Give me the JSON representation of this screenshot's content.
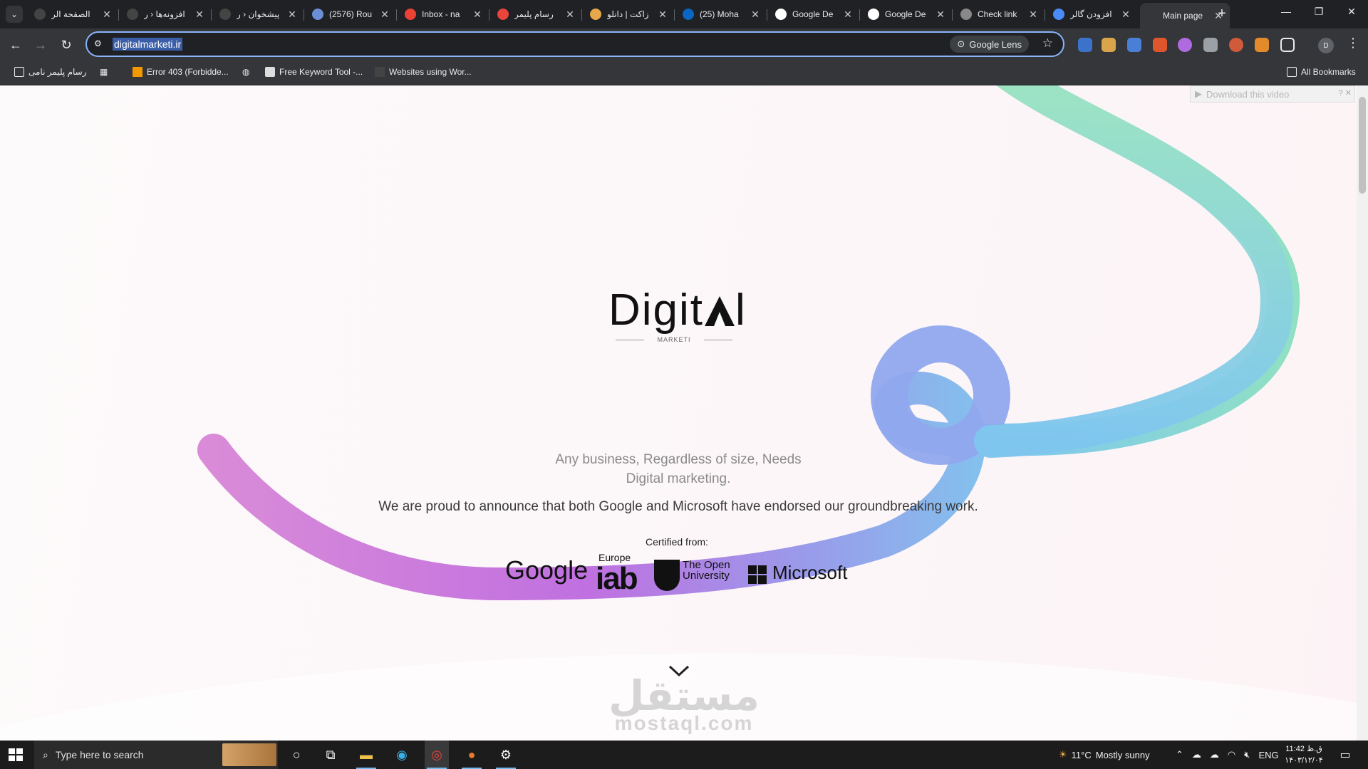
{
  "browser": {
    "tabs": [
      {
        "label": "الصفحة الر",
        "fav_color": "#444"
      },
      {
        "label": "افزونه‌ها ‹ ر",
        "fav_color": "#444"
      },
      {
        "label": "پیشخوان ‹ ر",
        "fav_color": "#444"
      },
      {
        "label": "(2576) Rou",
        "fav_color": "#6b8fd6"
      },
      {
        "label": "Inbox - na",
        "fav_color": "#ea4335"
      },
      {
        "label": "رسام پلیمر",
        "fav_color": "#e8453c"
      },
      {
        "label": "زاکت | دانلو",
        "fav_color": "#e6a84a"
      },
      {
        "label": "(25) Moha",
        "fav_color": "#0a66c2"
      },
      {
        "label": "Google De",
        "fav_color": "#ffffff"
      },
      {
        "label": "Google De",
        "fav_color": "#ffffff"
      },
      {
        "label": "Check link",
        "fav_color": "#888888"
      },
      {
        "label": "افزودن گالر",
        "fav_color": "#4a8cf7"
      },
      {
        "label": "Main page",
        "fav_color": "#35363a"
      }
    ],
    "new_tab_label": "+",
    "url": "digitalmarketi.ir",
    "lens_label": "Google Lens",
    "profile_initial": "D",
    "bookmarks": [
      {
        "label": "رسام پلیمر نامی"
      },
      {
        "label": "Error 403 (Forbidde..."
      },
      {
        "label": "Free Keyword Tool -..."
      },
      {
        "label": "Websites using Wor..."
      }
    ],
    "all_bookmarks_label": "All Bookmarks"
  },
  "page": {
    "download_video_label": "Download this video",
    "download_video_help": "? ✕",
    "logo_word": "Digit",
    "logo_tail": "l",
    "logo_sub": "MARKETI",
    "tagline_line1": "Any business, Regardless of size, Needs",
    "tagline_line2": "Digital marketing.",
    "announcement": "We are proud to announce that both Google and Microsoft have endorsed our groundbreaking work.",
    "certified_label": "Certified from:",
    "partners": {
      "google": "Google",
      "iab_region": "Europe",
      "iab": "iab",
      "ou_line1": "The Open",
      "ou_line2": "University",
      "microsoft": "Microsoft"
    },
    "watermark_ar": "مستقل",
    "watermark_lat": "mostaql.com"
  },
  "taskbar": {
    "search_placeholder": "Type here to search",
    "weather_temp": "11°C",
    "weather_text": "Mostly sunny",
    "language": "ENG",
    "time": "11:42 ق.ظ",
    "date": "۱۴۰۳/۱۲/۰۴"
  }
}
